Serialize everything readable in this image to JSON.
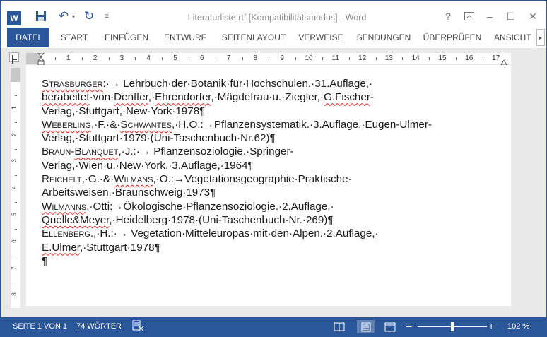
{
  "titlebar": {
    "logo_letter": "W",
    "title": "Literaturliste.rtf [Kompatibilitätsmodus] - Word",
    "help": "?",
    "minimize": "–",
    "maximize": "☐",
    "close": "✕"
  },
  "tabs": [
    "DATEI",
    "START",
    "EINFÜGEN",
    "ENTWURF",
    "SEITENLAYOUT",
    "VERWEISE",
    "SENDUNGEN",
    "ÜBERPRÜFEN",
    "ANSICHT"
  ],
  "ruler": {
    "numbers": [
      "1",
      "1",
      "2",
      "3",
      "4",
      "5",
      "6",
      "7",
      "8",
      "9",
      "10",
      "11",
      "12",
      "13",
      "14",
      "15",
      "16",
      "17"
    ],
    "vertical_numbers": [
      "1",
      "2",
      "3",
      "4",
      "5",
      "6",
      "7",
      "8"
    ]
  },
  "document": {
    "paragraphs": [
      [
        {
          "t": "Strasburger",
          "sc": true,
          "err": true
        },
        {
          "t": ":·→ Lehrbuch·der·Botanik·für·Hochschulen.·31.Auflage,· "
        },
        {
          "t": "berabeitet",
          "err": true
        },
        {
          "t": "·von·"
        },
        {
          "t": "Denffer",
          "err": true
        },
        {
          "t": ",·"
        },
        {
          "t": "Ehrendorfer",
          "err": true
        },
        {
          "t": ",·Mägdefrau·u.·Ziegler,·"
        },
        {
          "t": "G.Fischer",
          "err": true
        },
        {
          "t": "-Verlag,·Stuttgart,·New·York·1978¶"
        }
      ],
      [
        {
          "t": "Weberling",
          "sc": true,
          "err": true
        },
        {
          "t": ",·F.·&·"
        },
        {
          "t": "Schwantes",
          "sc": true,
          "err": true
        },
        {
          "t": ",·H.O.:→Pflanzensystematik.·3.Auflage,·Eugen-Ulmer-Verlag,·Stuttgart·1979·(Uni-Taschenbuch·Nr.62)¶"
        }
      ],
      [
        {
          "t": "Braun-",
          "sc": true
        },
        {
          "t": "Blanquet",
          "sc": true,
          "err": true
        },
        {
          "t": ",·J.:·→ Pflanzensoziologie.·Springer-Verlag,·Wien·u.·New·York,·3.Auflage,·1964¶"
        }
      ],
      [
        {
          "t": "Reichelt",
          "sc": true
        },
        {
          "t": ",·G.·&·"
        },
        {
          "t": "Wilmans",
          "sc": true,
          "err": true
        },
        {
          "t": ",·O.:→Vegetationsgeographie·Praktische· Arbeitsweisen.·Braunschweig·1973¶"
        }
      ],
      [
        {
          "t": "Wilmanns",
          "sc": true,
          "err": true
        },
        {
          "t": ",·Otti:→Ökologische·Pflanzensoziologie.·2.Auflage,· "
        },
        {
          "t": "Quelle&Meyer",
          "err": true
        },
        {
          "t": ",·Heidelberg·1978·(Uni-Taschenbuch·Nr.·269)¶"
        }
      ],
      [
        {
          "t": "Ellenberg",
          "sc": true
        },
        {
          "t": ".,·H.:·→ Vegetation·Mitteleuropas·mit·den·Alpen.·2.Auflage,· "
        },
        {
          "t": "E.Ulmer",
          "err": true
        },
        {
          "t": ",·Stuttgart·1978¶"
        }
      ],
      [
        {
          "t": "¶"
        }
      ]
    ]
  },
  "statusbar": {
    "page": "SEITE 1 VON 1",
    "words": "74 WÖRTER",
    "zoom_minus": "–",
    "zoom_plus": "+",
    "zoom": "102 %"
  },
  "colors": {
    "accent": "#2b579a",
    "spell_error": "#e02020"
  }
}
